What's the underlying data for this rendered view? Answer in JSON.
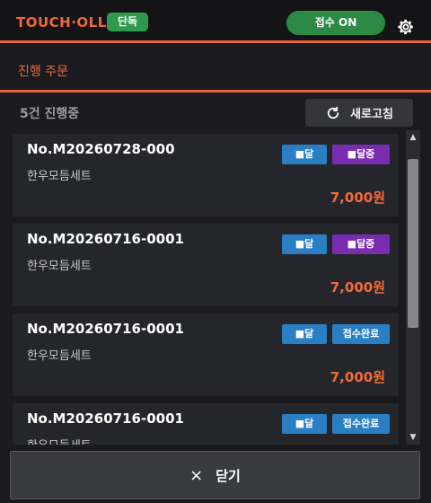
{
  "header": {
    "brand": "TOUCH·OLL",
    "badge": "단독",
    "toggle_label": "접수 ON",
    "settings_icon": "gear-icon"
  },
  "section": {
    "title": "진행 주문"
  },
  "toolbar": {
    "count_text": "5건 진행중",
    "refresh_label": "새로고침",
    "refresh_icon": "refresh-icon"
  },
  "orders": [
    {
      "order_no": "No.M20260728-000",
      "item": "한우모듬세트",
      "price": "7,000원",
      "type": "■달",
      "status": "■달중",
      "status_color": "#7a2cae"
    },
    {
      "order_no": "No.M20260716-0001",
      "item": "한우모듬세트",
      "price": "7,000원",
      "type": "■달",
      "status": "■달중",
      "status_color": "#7a2cae"
    },
    {
      "order_no": "No.M20260716-0001",
      "item": "한우모듬세트",
      "price": "7,000원",
      "type": "■달",
      "status": "접수완료",
      "status_color": "#2a7fc4"
    },
    {
      "order_no": "No.M20260716-0001",
      "item": "한우모듬세트",
      "price": "",
      "type": "■달",
      "status": "접수완료",
      "status_color": "#2a7fc4"
    }
  ],
  "footer": {
    "close_label": "닫기",
    "close_icon_glyph": "×"
  },
  "colors": {
    "accent": "#e8643a",
    "toggle_green": "#2c8a46",
    "type_blue": "#2a7fc4",
    "status_purple": "#7a2cae"
  }
}
